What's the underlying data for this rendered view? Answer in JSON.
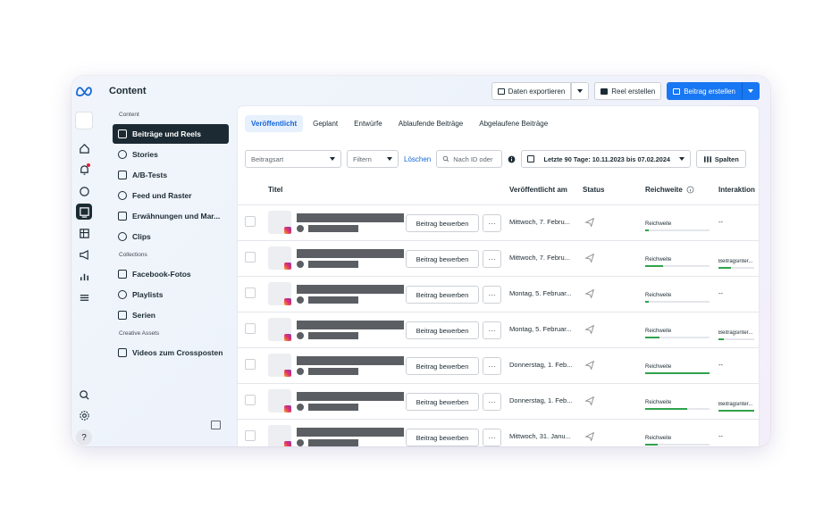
{
  "app": {
    "title": "Content"
  },
  "toolbar": {
    "export_label": "Daten exportieren",
    "reel_label": "Reel erstellen",
    "post_label": "Beitrag erstellen"
  },
  "nav": {
    "section_content": "Content",
    "section_collections": "Collections",
    "section_creative": "Creative Assets",
    "items_content": [
      "Beiträge und Reels",
      "Stories",
      "A/B-Tests",
      "Feed und Raster",
      "Erwähnungen und Mar...",
      "Clips"
    ],
    "items_collections": [
      "Facebook-Fotos",
      "Playlists",
      "Serien"
    ],
    "items_creative": [
      "Videos zum Crossposten"
    ]
  },
  "tabs": [
    "Veröffentlicht",
    "Geplant",
    "Entwürfe",
    "Ablaufende Beiträge",
    "Abgelaufene Beiträge"
  ],
  "filters": {
    "type_placeholder": "Beitragsart",
    "filter_placeholder": "Filtern",
    "clear_label": "Löschen",
    "search_placeholder": "Nach ID oder",
    "date_range": "Letzte 90 Tage: 10.11.2023 bis 07.02.2024",
    "columns_label": "Spalten"
  },
  "table": {
    "headers": {
      "title": "Titel",
      "published": "Veröffentlicht am",
      "status": "Status",
      "reach": "Reichweite",
      "interactions": "Interaktion"
    },
    "promote_label": "Beitrag bewerben",
    "more_label": "···",
    "reach_label": "Reichweite",
    "rows": [
      {
        "date": "Mittwoch, 7. Febru...",
        "reach_fill": 0.06,
        "interactions": "--",
        "inter_fill": 0
      },
      {
        "date": "Mittwoch, 7. Febru...",
        "reach_fill": 0.28,
        "interactions": "Beitragsinter...",
        "inter_fill": 0.35
      },
      {
        "date": "Montag, 5. Februar...",
        "reach_fill": 0.05,
        "interactions": "--",
        "inter_fill": 0
      },
      {
        "date": "Montag, 5. Februar...",
        "reach_fill": 0.22,
        "interactions": "Beitragsinter...",
        "inter_fill": 0.15
      },
      {
        "date": "Donnerstag, 1. Feb...",
        "reach_fill": 1.0,
        "interactions": "--",
        "inter_fill": 0
      },
      {
        "date": "Donnerstag, 1. Feb...",
        "reach_fill": 0.65,
        "interactions": "Beitragsinter...",
        "inter_fill": 1.0
      },
      {
        "date": "Mittwoch, 31. Janu...",
        "reach_fill": 0.2,
        "interactions": "--",
        "inter_fill": 0
      }
    ]
  },
  "colors": {
    "accent": "#1877f2",
    "dark": "#1c2b33",
    "progress": "#31a24c"
  }
}
